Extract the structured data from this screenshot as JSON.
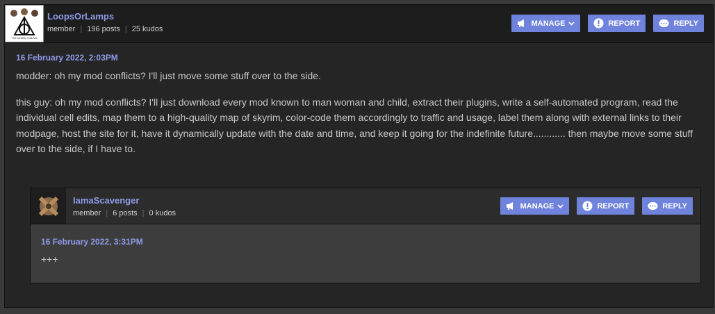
{
  "post": {
    "username": "LoopsOrLamps",
    "role": "member",
    "posts": "196 posts",
    "kudos": "25 kudos",
    "avatar_icon": "deathly-hallows-avatar",
    "avatar_caption": "The Deathly Hallows",
    "date": "16 February 2022, 2:03PM",
    "paragraphs": [
      "modder: oh my mod conflicts? I'll just move some stuff over to the side.",
      "this guy: oh my mod conflicts? I'll just download every mod known to man woman and child, extract their plugins, write a self-automated program, read the individual cell edits, map them to a high-quality map of skyrim, color-code them accordingly to traffic and usage, label them along with external links to their modpage, host the site for it, have it dynamically update with the date and time, and keep it going for the indefinite future............ then maybe move some stuff over to the side, if I have to."
    ],
    "actions": {
      "manage": "MANAGE",
      "report": "REPORT",
      "reply": "REPLY"
    }
  },
  "reply": {
    "username": "IamaScavenger",
    "role": "member",
    "posts": "6 posts",
    "kudos": "0 kudos",
    "avatar_icon": "scavenger-avatar",
    "date": "16 February 2022, 3:31PM",
    "body": "+++",
    "actions": {
      "manage": "MANAGE",
      "report": "REPORT",
      "reply": "REPLY"
    }
  },
  "colors": {
    "accent": "#6f83dc",
    "link": "#8e9be8",
    "background": "#252525"
  }
}
